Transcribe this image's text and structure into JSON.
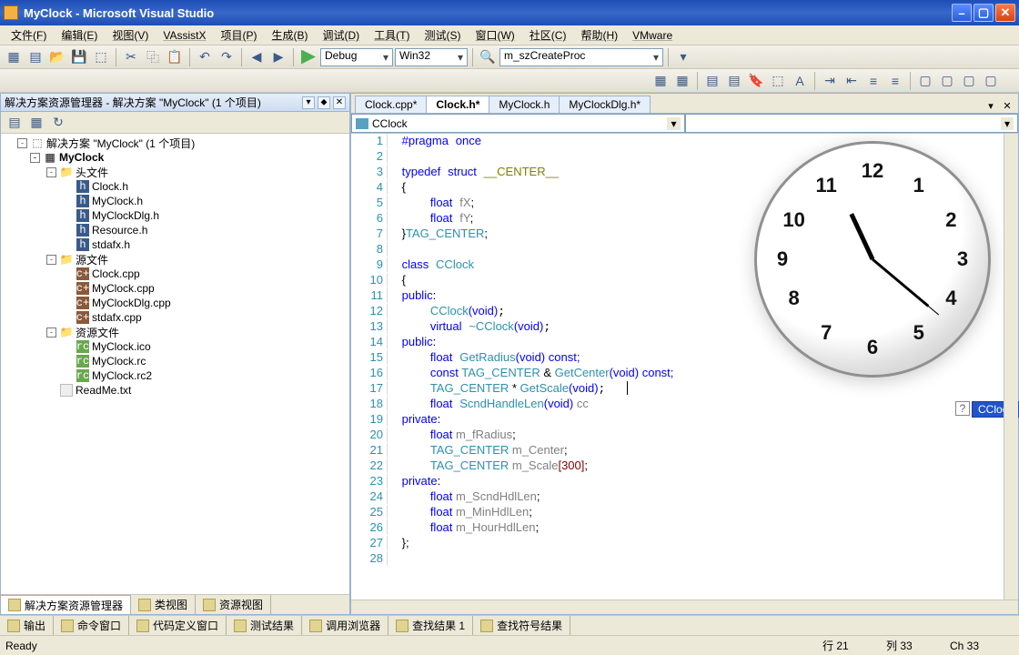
{
  "title": "MyClock - Microsoft Visual Studio",
  "menu": [
    "文件(F)",
    "编辑(E)",
    "视图(V)",
    "VAssistX",
    "项目(P)",
    "生成(B)",
    "调试(D)",
    "工具(T)",
    "测试(S)",
    "窗口(W)",
    "社区(C)",
    "帮助(H)",
    "VMware"
  ],
  "toolbar1": {
    "config": "Debug",
    "platform": "Win32",
    "proc": "m_szCreateProc"
  },
  "solexp": {
    "title": "解决方案资源管理器 - 解决方案 \"MyClock\" (1 个项目)",
    "root": "解决方案 \"MyClock\" (1 个项目)",
    "project": "MyClock",
    "folders": {
      "headers": {
        "label": "头文件",
        "items": [
          "Clock.h",
          "MyClock.h",
          "MyClockDlg.h",
          "Resource.h",
          "stdafx.h"
        ]
      },
      "sources": {
        "label": "源文件",
        "items": [
          "Clock.cpp",
          "MyClock.cpp",
          "MyClockDlg.cpp",
          "stdafx.cpp"
        ]
      },
      "resources": {
        "label": "资源文件",
        "items": [
          "MyClock.ico",
          "MyClock.rc",
          "MyClock.rc2"
        ]
      }
    },
    "readme": "ReadMe.txt",
    "bottom_tabs": [
      "解决方案资源管理器",
      "类视图",
      "资源视图"
    ]
  },
  "editor": {
    "tabs": [
      "Clock.cpp*",
      "Clock.h*",
      "MyClock.h",
      "MyClockDlg.h*"
    ],
    "active_tab": 1,
    "scope": "CClock",
    "lines": [
      "1",
      "2",
      "3",
      "4",
      "5",
      "6",
      "7",
      "8",
      "9",
      "10",
      "11",
      "12",
      "13",
      "14",
      "15",
      "16",
      "17",
      "18",
      "19",
      "20",
      "21",
      "22",
      "23",
      "24",
      "25",
      "26",
      "27",
      "28"
    ],
    "intellisense": "CClock",
    "code": {
      "l1": {
        "pragma": "#pragma",
        "once": "once"
      },
      "l3a": {
        "typedef": "typedef",
        "struct": "struct",
        "name": "__CENTER__"
      },
      "l4": "{",
      "l5": {
        "float": "float",
        "var": "fX",
        "semi": ";"
      },
      "l6": {
        "float": "float",
        "var": "fY",
        "semi": ";"
      },
      "l7": {
        "close": "}",
        "tag": "TAG_CENTER",
        "semi": ";"
      },
      "l9": {
        "class": "class",
        "name": "CClock"
      },
      "l10": "{",
      "l11": {
        "public": "public",
        "colon": ":"
      },
      "l12": {
        "ctor": "CClock",
        "args": "(void);"
      },
      "l13": {
        "virtual": "virtual",
        "dtor": "~CClock",
        "args": "(void);"
      },
      "l14": {
        "public": "public",
        "colon": ":"
      },
      "l15": {
        "float": "float",
        "name": "GetRadius",
        "args": "(void)",
        "const": " const;"
      },
      "l16": {
        "const": "const ",
        "type": "TAG_CENTER",
        "amp": " & ",
        "name": "GetCenter",
        "args": "(void)",
        "tail": " const;"
      },
      "l17": {
        "type": "TAG_CENTER",
        "star": " * ",
        "name": "GetScale",
        "args": "(void);",
        "cursor": "|"
      },
      "l18": {
        "float": "float",
        "name": "ScndHandleLen",
        "args": "(void)",
        "partial": " cc"
      },
      "l19": {
        "private": "private",
        "colon": ":"
      },
      "l20": {
        "float": "float",
        "var": " m_fRadius",
        "semi": ";"
      },
      "l21": {
        "type": "TAG_CENTER",
        "var": " m_Center",
        "semi": ";"
      },
      "l22": {
        "type": "TAG_CENTER",
        "var": " m_Scale",
        "arr": "[300]",
        "semi": ";"
      },
      "l23": {
        "private": "private",
        "colon": ":"
      },
      "l24": {
        "float": "float",
        "var": " m_ScndHdlLen",
        "semi": ";"
      },
      "l25": {
        "float": "float",
        "var": " m_MinHdlLen",
        "semi": ";"
      },
      "l26": {
        "float": "float",
        "var": " m_HourHdlLen",
        "semi": ";"
      },
      "l27": "};"
    }
  },
  "output_tabs": [
    "输出",
    "命令窗口",
    "代码定义窗口",
    "测试结果",
    "调用浏览器",
    "查找结果 1",
    "查找符号结果"
  ],
  "status": {
    "ready": "Ready",
    "line": "行 21",
    "col": "列 33",
    "ch": "Ch 33"
  },
  "clock_nums": [
    "12",
    "1",
    "2",
    "3",
    "4",
    "5",
    "6",
    "7",
    "8",
    "9",
    "10",
    "11"
  ]
}
